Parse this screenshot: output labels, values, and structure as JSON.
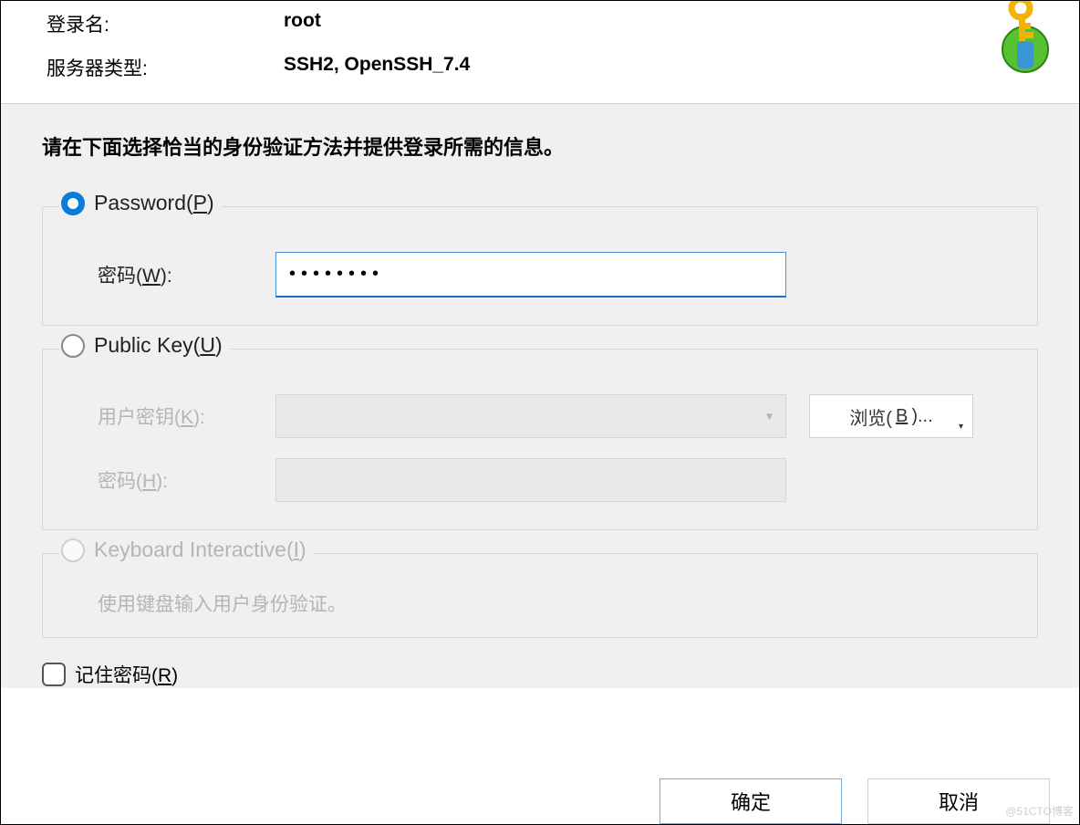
{
  "header": {
    "loginLabel": "登录名:",
    "loginValue": "root",
    "serverTypeLabel": "服务器类型:",
    "serverTypeValue": "SSH2, OpenSSH_7.4"
  },
  "instruction": "请在下面选择恰当的身份验证方法并提供登录所需的信息。",
  "passwordGroup": {
    "title_pre": "Password(",
    "title_hot": "P",
    "title_post": ")",
    "passwordLabel_pre": "密码(",
    "passwordLabel_hot": "W",
    "passwordLabel_post": "):",
    "passwordValue": "••••••••"
  },
  "publicKeyGroup": {
    "title_pre": "Public Key(",
    "title_hot": "U",
    "title_post": ")",
    "userKeyLabel_pre": "用户密钥(",
    "userKeyLabel_hot": "K",
    "userKeyLabel_post": "):",
    "browse_pre": "浏览(",
    "browse_hot": "B",
    "browse_post": ")...",
    "passLabel_pre": "密码(",
    "passLabel_hot": "H",
    "passLabel_post": "):"
  },
  "keyboardGroup": {
    "title_pre": "Keyboard Interactive(",
    "title_hot": "I",
    "title_post": ")",
    "desc": "使用键盘输入用户身份验证。"
  },
  "remember_pre": "记住密码(",
  "remember_hot": "R",
  "remember_post": ")",
  "okBtn": "确定",
  "cancelBtn": "取消",
  "watermark": "@51CTO博客"
}
